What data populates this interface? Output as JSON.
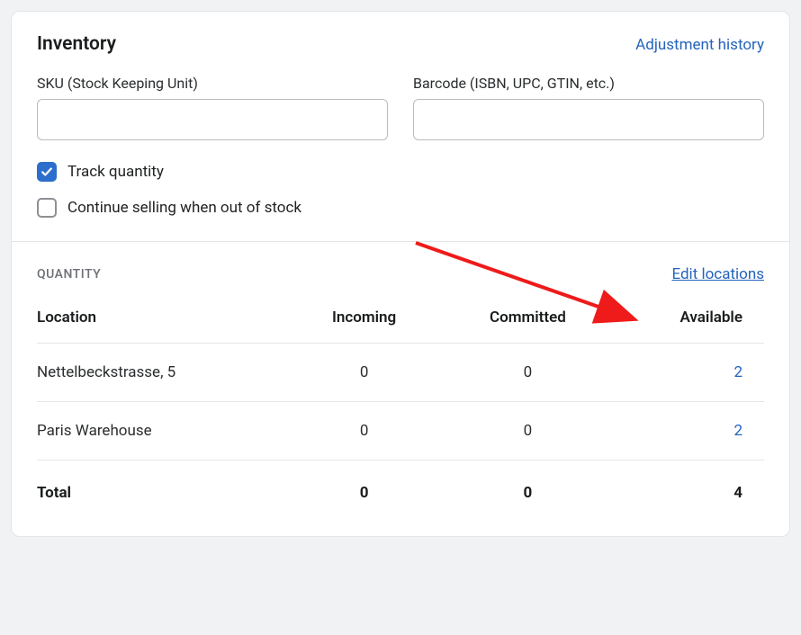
{
  "header": {
    "title": "Inventory",
    "history_link": "Adjustment history"
  },
  "fields": {
    "sku_label": "SKU (Stock Keeping Unit)",
    "sku_value": "",
    "barcode_label": "Barcode (ISBN, UPC, GTIN, etc.)",
    "barcode_value": ""
  },
  "checkboxes": {
    "track_label": "Track quantity",
    "continue_label": "Continue selling when out of stock"
  },
  "quantity": {
    "subheader": "QUANTITY",
    "edit_link": "Edit locations",
    "columns": {
      "location": "Location",
      "incoming": "Incoming",
      "committed": "Committed",
      "available": "Available"
    },
    "rows": [
      {
        "location": "Nettelbeckstrasse, 5",
        "incoming": "0",
        "committed": "0",
        "available": "2"
      },
      {
        "location": "Paris Warehouse",
        "incoming": "0",
        "committed": "0",
        "available": "2"
      }
    ],
    "total": {
      "label": "Total",
      "incoming": "0",
      "committed": "0",
      "available": "4"
    }
  }
}
